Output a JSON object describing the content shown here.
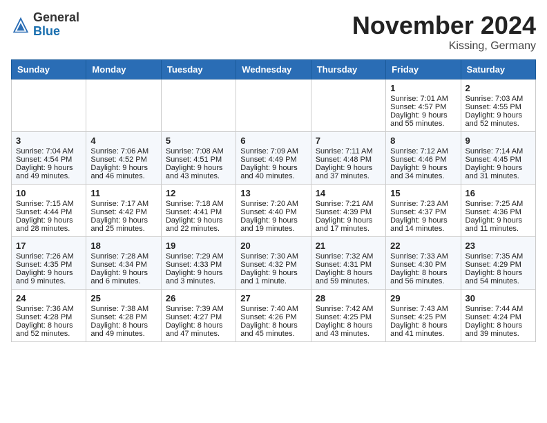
{
  "header": {
    "logo": {
      "line1": "General",
      "line2": "Blue"
    },
    "title": "November 2024",
    "location": "Kissing, Germany"
  },
  "weekdays": [
    "Sunday",
    "Monday",
    "Tuesday",
    "Wednesday",
    "Thursday",
    "Friday",
    "Saturday"
  ],
  "weeks": [
    [
      {
        "day": "",
        "sunrise": "",
        "sunset": "",
        "daylight": ""
      },
      {
        "day": "",
        "sunrise": "",
        "sunset": "",
        "daylight": ""
      },
      {
        "day": "",
        "sunrise": "",
        "sunset": "",
        "daylight": ""
      },
      {
        "day": "",
        "sunrise": "",
        "sunset": "",
        "daylight": ""
      },
      {
        "day": "",
        "sunrise": "",
        "sunset": "",
        "daylight": ""
      },
      {
        "day": "1",
        "sunrise": "Sunrise: 7:01 AM",
        "sunset": "Sunset: 4:57 PM",
        "daylight": "Daylight: 9 hours and 55 minutes."
      },
      {
        "day": "2",
        "sunrise": "Sunrise: 7:03 AM",
        "sunset": "Sunset: 4:55 PM",
        "daylight": "Daylight: 9 hours and 52 minutes."
      }
    ],
    [
      {
        "day": "3",
        "sunrise": "Sunrise: 7:04 AM",
        "sunset": "Sunset: 4:54 PM",
        "daylight": "Daylight: 9 hours and 49 minutes."
      },
      {
        "day": "4",
        "sunrise": "Sunrise: 7:06 AM",
        "sunset": "Sunset: 4:52 PM",
        "daylight": "Daylight: 9 hours and 46 minutes."
      },
      {
        "day": "5",
        "sunrise": "Sunrise: 7:08 AM",
        "sunset": "Sunset: 4:51 PM",
        "daylight": "Daylight: 9 hours and 43 minutes."
      },
      {
        "day": "6",
        "sunrise": "Sunrise: 7:09 AM",
        "sunset": "Sunset: 4:49 PM",
        "daylight": "Daylight: 9 hours and 40 minutes."
      },
      {
        "day": "7",
        "sunrise": "Sunrise: 7:11 AM",
        "sunset": "Sunset: 4:48 PM",
        "daylight": "Daylight: 9 hours and 37 minutes."
      },
      {
        "day": "8",
        "sunrise": "Sunrise: 7:12 AM",
        "sunset": "Sunset: 4:46 PM",
        "daylight": "Daylight: 9 hours and 34 minutes."
      },
      {
        "day": "9",
        "sunrise": "Sunrise: 7:14 AM",
        "sunset": "Sunset: 4:45 PM",
        "daylight": "Daylight: 9 hours and 31 minutes."
      }
    ],
    [
      {
        "day": "10",
        "sunrise": "Sunrise: 7:15 AM",
        "sunset": "Sunset: 4:44 PM",
        "daylight": "Daylight: 9 hours and 28 minutes."
      },
      {
        "day": "11",
        "sunrise": "Sunrise: 7:17 AM",
        "sunset": "Sunset: 4:42 PM",
        "daylight": "Daylight: 9 hours and 25 minutes."
      },
      {
        "day": "12",
        "sunrise": "Sunrise: 7:18 AM",
        "sunset": "Sunset: 4:41 PM",
        "daylight": "Daylight: 9 hours and 22 minutes."
      },
      {
        "day": "13",
        "sunrise": "Sunrise: 7:20 AM",
        "sunset": "Sunset: 4:40 PM",
        "daylight": "Daylight: 9 hours and 19 minutes."
      },
      {
        "day": "14",
        "sunrise": "Sunrise: 7:21 AM",
        "sunset": "Sunset: 4:39 PM",
        "daylight": "Daylight: 9 hours and 17 minutes."
      },
      {
        "day": "15",
        "sunrise": "Sunrise: 7:23 AM",
        "sunset": "Sunset: 4:37 PM",
        "daylight": "Daylight: 9 hours and 14 minutes."
      },
      {
        "day": "16",
        "sunrise": "Sunrise: 7:25 AM",
        "sunset": "Sunset: 4:36 PM",
        "daylight": "Daylight: 9 hours and 11 minutes."
      }
    ],
    [
      {
        "day": "17",
        "sunrise": "Sunrise: 7:26 AM",
        "sunset": "Sunset: 4:35 PM",
        "daylight": "Daylight: 9 hours and 9 minutes."
      },
      {
        "day": "18",
        "sunrise": "Sunrise: 7:28 AM",
        "sunset": "Sunset: 4:34 PM",
        "daylight": "Daylight: 9 hours and 6 minutes."
      },
      {
        "day": "19",
        "sunrise": "Sunrise: 7:29 AM",
        "sunset": "Sunset: 4:33 PM",
        "daylight": "Daylight: 9 hours and 3 minutes."
      },
      {
        "day": "20",
        "sunrise": "Sunrise: 7:30 AM",
        "sunset": "Sunset: 4:32 PM",
        "daylight": "Daylight: 9 hours and 1 minute."
      },
      {
        "day": "21",
        "sunrise": "Sunrise: 7:32 AM",
        "sunset": "Sunset: 4:31 PM",
        "daylight": "Daylight: 8 hours and 59 minutes."
      },
      {
        "day": "22",
        "sunrise": "Sunrise: 7:33 AM",
        "sunset": "Sunset: 4:30 PM",
        "daylight": "Daylight: 8 hours and 56 minutes."
      },
      {
        "day": "23",
        "sunrise": "Sunrise: 7:35 AM",
        "sunset": "Sunset: 4:29 PM",
        "daylight": "Daylight: 8 hours and 54 minutes."
      }
    ],
    [
      {
        "day": "24",
        "sunrise": "Sunrise: 7:36 AM",
        "sunset": "Sunset: 4:28 PM",
        "daylight": "Daylight: 8 hours and 52 minutes."
      },
      {
        "day": "25",
        "sunrise": "Sunrise: 7:38 AM",
        "sunset": "Sunset: 4:28 PM",
        "daylight": "Daylight: 8 hours and 49 minutes."
      },
      {
        "day": "26",
        "sunrise": "Sunrise: 7:39 AM",
        "sunset": "Sunset: 4:27 PM",
        "daylight": "Daylight: 8 hours and 47 minutes."
      },
      {
        "day": "27",
        "sunrise": "Sunrise: 7:40 AM",
        "sunset": "Sunset: 4:26 PM",
        "daylight": "Daylight: 8 hours and 45 minutes."
      },
      {
        "day": "28",
        "sunrise": "Sunrise: 7:42 AM",
        "sunset": "Sunset: 4:25 PM",
        "daylight": "Daylight: 8 hours and 43 minutes."
      },
      {
        "day": "29",
        "sunrise": "Sunrise: 7:43 AM",
        "sunset": "Sunset: 4:25 PM",
        "daylight": "Daylight: 8 hours and 41 minutes."
      },
      {
        "day": "30",
        "sunrise": "Sunrise: 7:44 AM",
        "sunset": "Sunset: 4:24 PM",
        "daylight": "Daylight: 8 hours and 39 minutes."
      }
    ]
  ]
}
